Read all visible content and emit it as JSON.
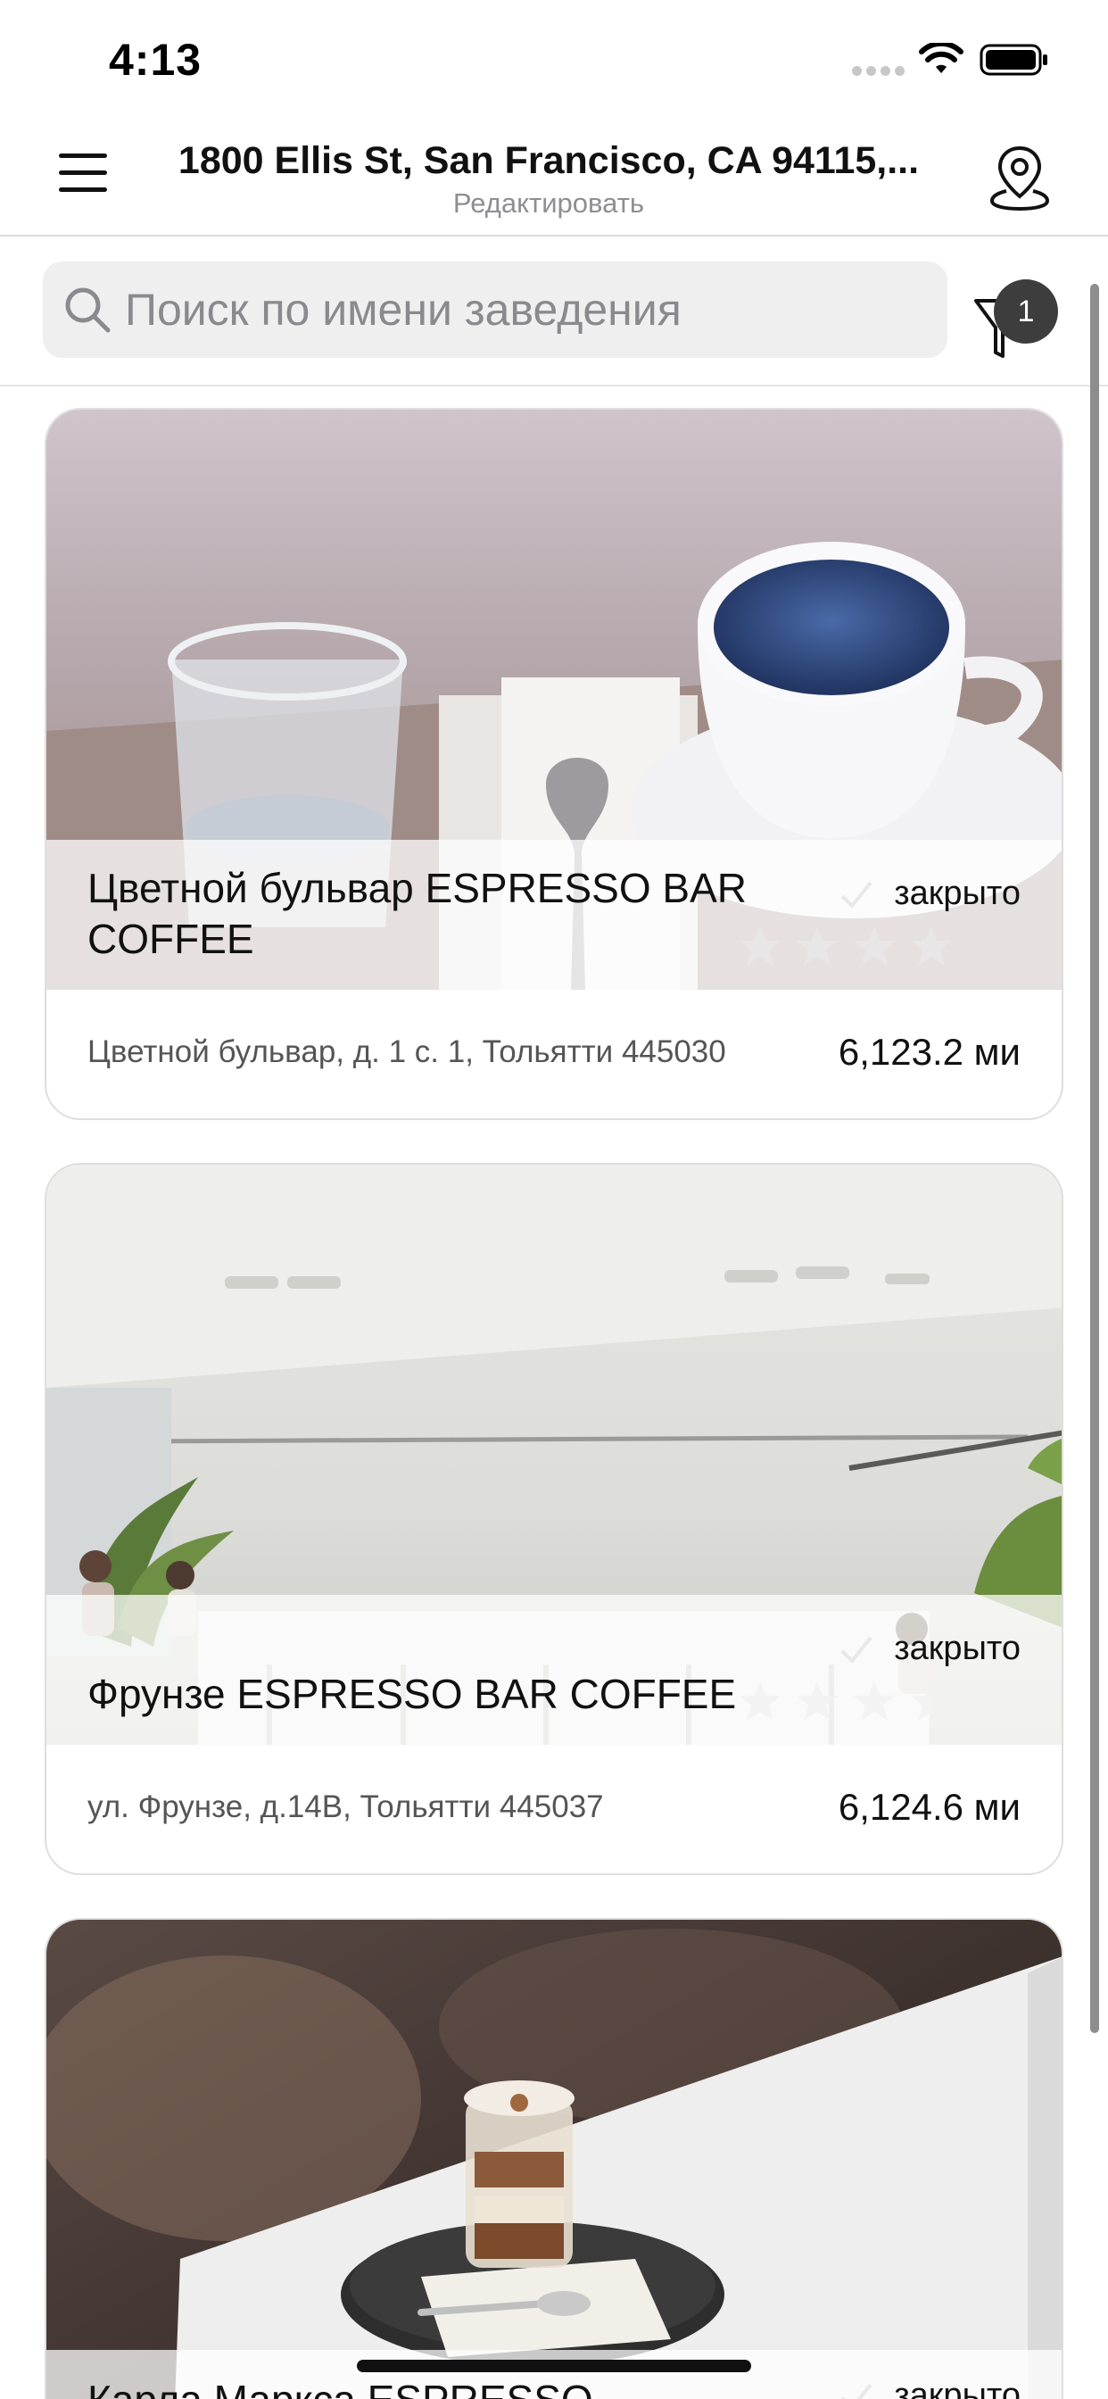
{
  "status_bar": {
    "time": "4:13"
  },
  "header": {
    "address": "1800 Ellis St, San Francisco, CA 94115,...",
    "edit_label": "Редактировать"
  },
  "search": {
    "placeholder": "Поиск по имени заведения"
  },
  "filter": {
    "badge_count": "1"
  },
  "places": [
    {
      "name": "Цветной бульвар ESPRESSO BAR COFFEE",
      "status": "закрыто",
      "address": "Цветной бульвар, д. 1 с. 1, Тольятти 445030",
      "distance": "6,123.2 ми",
      "image": "coffee-cup-and-water-glass"
    },
    {
      "name": "Фрунзе ESPRESSO BAR COFFEE",
      "status": "закрыто",
      "address": "ул. Фрунзе, д.14В, Тольятти 445037",
      "distance": "6,124.6 ми",
      "image": "cafe-interior"
    },
    {
      "name": "Карла Маркса ESPRESSO",
      "status": "закрыто",
      "image": "dessert-on-tray"
    }
  ],
  "colors": {
    "badge": "#3d3d3d",
    "search_bg": "#efefef",
    "secondary_text": "#8e8e93"
  }
}
